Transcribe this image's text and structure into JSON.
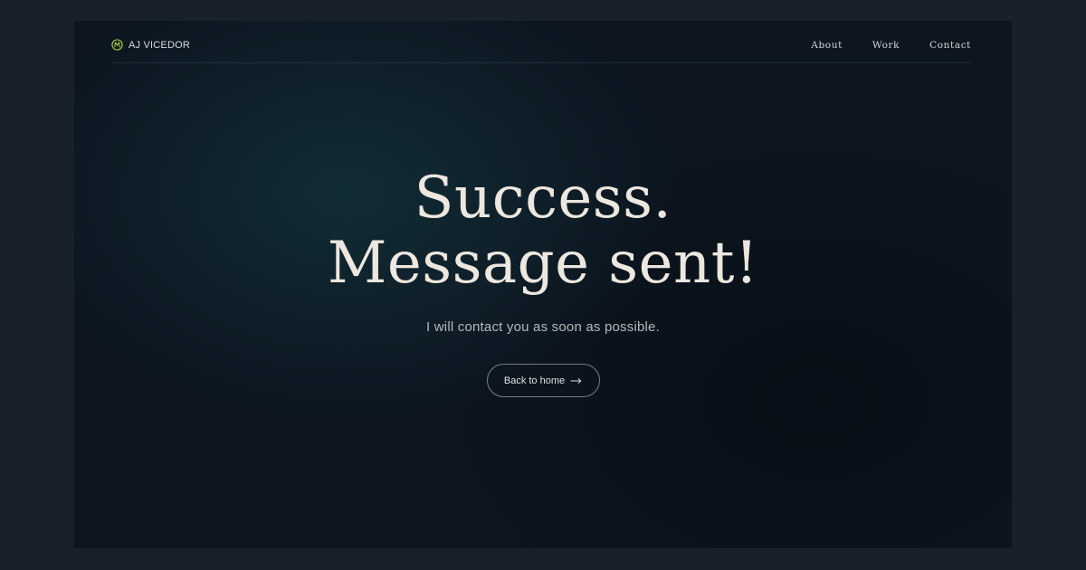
{
  "brand": {
    "name": "AJ VICEDOR",
    "logo_icon": "monogram-logo-icon",
    "accent": "#a4c63a"
  },
  "nav": {
    "items": [
      {
        "label": "About"
      },
      {
        "label": "Work"
      },
      {
        "label": "Contact"
      }
    ]
  },
  "hero": {
    "title_line1": "Success.",
    "title_line2": "Message sent!",
    "subtitle": "I will contact you as soon as possible.",
    "cta_label": "Back to home",
    "cta_icon": "arrow-right-icon"
  },
  "colors": {
    "page_bg": "#18202a",
    "frame_bg": "#0c1520",
    "headline": "#ece7df"
  }
}
